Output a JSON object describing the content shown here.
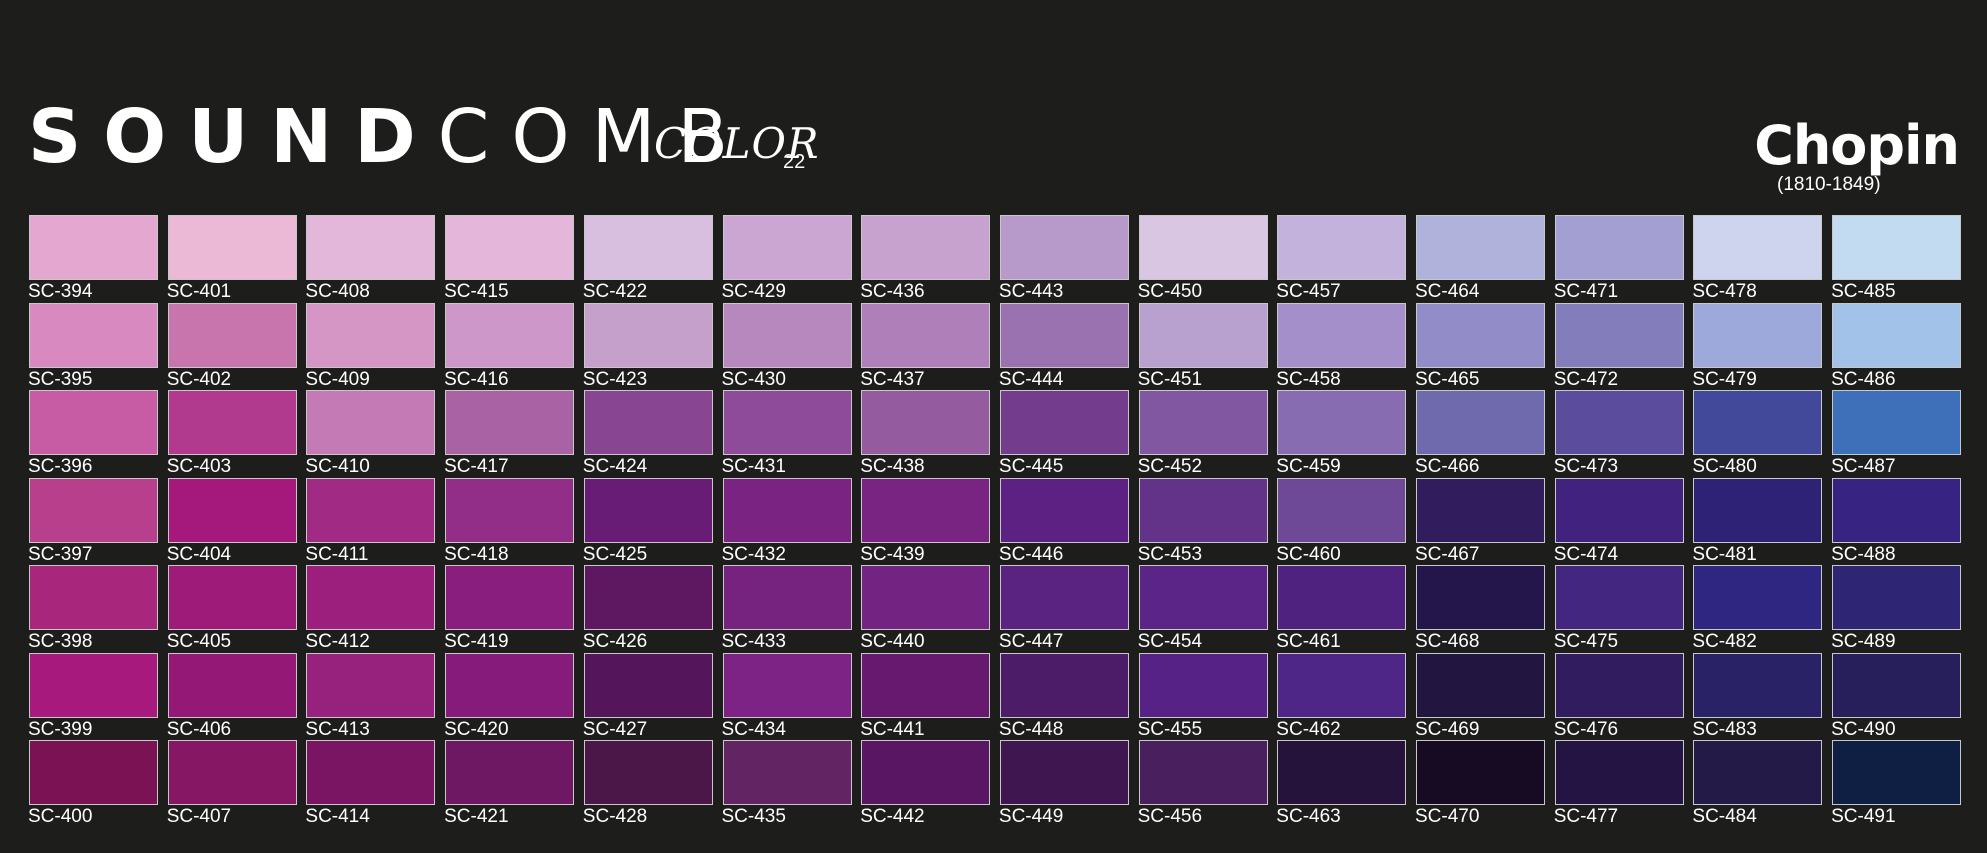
{
  "brand": {
    "part1": "SOUND",
    "part2": "COMB",
    "color_label": "COLOR",
    "color_number": "22"
  },
  "composer": {
    "name": "Chopin",
    "years": "(1810-1849)"
  },
  "swatches": [
    {
      "code": "SC-394",
      "color": "#e4a7cf"
    },
    {
      "code": "SC-395",
      "color": "#d889bf"
    },
    {
      "code": "SC-396",
      "color": "#c75ba4"
    },
    {
      "code": "SC-397",
      "color": "#b83f8c"
    },
    {
      "code": "SC-398",
      "color": "#a8277d"
    },
    {
      "code": "SC-399",
      "color": "#a8197e"
    },
    {
      "code": "SC-400",
      "color": "#7a1254"
    },
    {
      "code": "SC-401",
      "color": "#ebb8d6"
    },
    {
      "code": "SC-402",
      "color": "#c874ad"
    },
    {
      "code": "SC-403",
      "color": "#b1398e"
    },
    {
      "code": "SC-404",
      "color": "#a5197d"
    },
    {
      "code": "SC-405",
      "color": "#9e1b7a"
    },
    {
      "code": "SC-406",
      "color": "#941976"
    },
    {
      "code": "SC-407",
      "color": "#861764"
    },
    {
      "code": "SC-408",
      "color": "#e2b7d9"
    },
    {
      "code": "SC-409",
      "color": "#d596c5"
    },
    {
      "code": "SC-410",
      "color": "#c47ab4"
    },
    {
      "code": "SC-411",
      "color": "#a02a84"
    },
    {
      "code": "SC-412",
      "color": "#9c1f7e"
    },
    {
      "code": "SC-413",
      "color": "#97227e"
    },
    {
      "code": "SC-414",
      "color": "#7a1563"
    },
    {
      "code": "SC-415",
      "color": "#e3b6da"
    },
    {
      "code": "SC-416",
      "color": "#cd98c9"
    },
    {
      "code": "SC-417",
      "color": "#a962a3"
    },
    {
      "code": "SC-418",
      "color": "#922d88"
    },
    {
      "code": "SC-419",
      "color": "#891e7f"
    },
    {
      "code": "SC-420",
      "color": "#861b7b"
    },
    {
      "code": "SC-421",
      "color": "#6e1762"
    },
    {
      "code": "SC-422",
      "color": "#d8bedf"
    },
    {
      "code": "SC-423",
      "color": "#c5a0cb"
    },
    {
      "code": "SC-424",
      "color": "#874592"
    },
    {
      "code": "SC-425",
      "color": "#681c75"
    },
    {
      "code": "SC-426",
      "color": "#5e1861"
    },
    {
      "code": "SC-427",
      "color": "#55155a"
    },
    {
      "code": "SC-428",
      "color": "#4a1748"
    },
    {
      "code": "SC-429",
      "color": "#cca6d3"
    },
    {
      "code": "SC-430",
      "color": "#b688be"
    },
    {
      "code": "SC-431",
      "color": "#8e4b99"
    },
    {
      "code": "SC-432",
      "color": "#7a2383"
    },
    {
      "code": "SC-433",
      "color": "#762380"
    },
    {
      "code": "SC-434",
      "color": "#7c2385"
    },
    {
      "code": "SC-435",
      "color": "#632463"
    },
    {
      "code": "SC-436",
      "color": "#c7a2ce"
    },
    {
      "code": "SC-437",
      "color": "#ae7fb8"
    },
    {
      "code": "SC-438",
      "color": "#945b9f"
    },
    {
      "code": "SC-439",
      "color": "#792483"
    },
    {
      "code": "SC-440",
      "color": "#732382"
    },
    {
      "code": "SC-441",
      "color": "#67196f"
    },
    {
      "code": "SC-442",
      "color": "#591662"
    },
    {
      "code": "SC-443",
      "color": "#b89aca"
    },
    {
      "code": "SC-444",
      "color": "#9b72b0"
    },
    {
      "code": "SC-445",
      "color": "#733c8c"
    },
    {
      "code": "SC-446",
      "color": "#5d2083"
    },
    {
      "code": "SC-447",
      "color": "#5a2281"
    },
    {
      "code": "SC-448",
      "color": "#4d1c68"
    },
    {
      "code": "SC-449",
      "color": "#3f164f"
    },
    {
      "code": "SC-450",
      "color": "#d8c6e3"
    },
    {
      "code": "SC-451",
      "color": "#b9a1cf"
    },
    {
      "code": "SC-452",
      "color": "#8257a1"
    },
    {
      "code": "SC-453",
      "color": "#623389"
    },
    {
      "code": "SC-454",
      "color": "#5b2587"
    },
    {
      "code": "SC-455",
      "color": "#562286"
    },
    {
      "code": "SC-456",
      "color": "#4a1f5e"
    },
    {
      "code": "SC-457",
      "color": "#c3b2dc"
    },
    {
      "code": "SC-458",
      "color": "#a58fca"
    },
    {
      "code": "SC-459",
      "color": "#876cb2"
    },
    {
      "code": "SC-460",
      "color": "#6d4998"
    },
    {
      "code": "SC-461",
      "color": "#502280"
    },
    {
      "code": "SC-462",
      "color": "#4e2688"
    },
    {
      "code": "SC-463",
      "color": "#26133c"
    },
    {
      "code": "SC-464",
      "color": "#b1b2dc"
    },
    {
      "code": "SC-465",
      "color": "#928dc8"
    },
    {
      "code": "SC-466",
      "color": "#6e6aad"
    },
    {
      "code": "SC-467",
      "color": "#311c5e"
    },
    {
      "code": "SC-468",
      "color": "#24164a"
    },
    {
      "code": "SC-469",
      "color": "#221540"
    },
    {
      "code": "SC-470",
      "color": "#170b23"
    },
    {
      "code": "SC-471",
      "color": "#a39fd2"
    },
    {
      "code": "SC-472",
      "color": "#847dbb"
    },
    {
      "code": "SC-473",
      "color": "#5c4c9e"
    },
    {
      "code": "SC-474",
      "color": "#41237f"
    },
    {
      "code": "SC-475",
      "color": "#42267f"
    },
    {
      "code": "SC-476",
      "color": "#311c5f"
    },
    {
      "code": "SC-477",
      "color": "#231444"
    },
    {
      "code": "SC-478",
      "color": "#ced3ee"
    },
    {
      "code": "SC-479",
      "color": "#9ca9da"
    },
    {
      "code": "SC-480",
      "color": "#43499a"
    },
    {
      "code": "SC-481",
      "color": "#2e2276"
    },
    {
      "code": "SC-482",
      "color": "#2e2680"
    },
    {
      "code": "SC-483",
      "color": "#2a2267"
    },
    {
      "code": "SC-484",
      "color": "#231a48"
    },
    {
      "code": "SC-485",
      "color": "#c3dbf1"
    },
    {
      "code": "SC-486",
      "color": "#a2c2ea"
    },
    {
      "code": "SC-487",
      "color": "#3d70b8"
    },
    {
      "code": "SC-488",
      "color": "#362382"
    },
    {
      "code": "SC-489",
      "color": "#2e2575"
    },
    {
      "code": "SC-490",
      "color": "#261f5b"
    },
    {
      "code": "SC-491",
      "color": "#0f1f44"
    }
  ]
}
